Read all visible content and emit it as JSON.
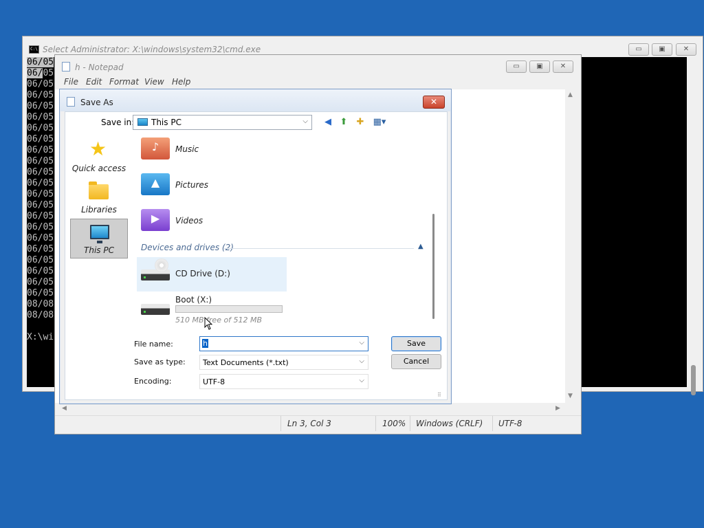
{
  "cmd": {
    "title": "Select Administrator: X:\\windows\\system32\\cmd.exe",
    "icon_text": "C:\\",
    "min_glyph": "▭",
    "max_glyph": "▣",
    "close_glyph": "✕",
    "lines": [
      "06/05",
      "06/05",
      "06/05",
      "06/05",
      "06/05",
      "06/05",
      "06/05",
      "06/05",
      "06/05",
      "06/05",
      "06/05",
      "06/05",
      "06/05",
      "06/05",
      "06/05",
      "06/05",
      "06/05",
      "06/05",
      "06/05",
      "06/05",
      "06/05",
      "06/05",
      "08/08",
      "08/08",
      "",
      "X:\\wi"
    ],
    "first_line": "06/05",
    "second_line_sel": "06/",
    "second_line_rest": "05"
  },
  "notepad": {
    "title": "h - Notepad",
    "menu": [
      "File",
      "Edit",
      "Format",
      "View",
      "Help"
    ],
    "status": {
      "position": "Ln 3, Col 3",
      "zoom": "100%",
      "line_endings": "Windows (CRLF)",
      "encoding": "UTF-8"
    }
  },
  "dialog": {
    "title": "Save As",
    "save_in_label": "Save in:",
    "save_in_value": "This PC",
    "places": [
      {
        "label": "Quick access",
        "icon": "star-icon"
      },
      {
        "label": "Libraries",
        "icon": "folder-icon"
      },
      {
        "label": "This PC",
        "icon": "computer-icon",
        "selected": true
      }
    ],
    "folders": [
      {
        "name": "Music",
        "icon": "music-folder-icon"
      },
      {
        "name": "Pictures",
        "icon": "pictures-folder-icon"
      },
      {
        "name": "Videos",
        "icon": "videos-folder-icon"
      }
    ],
    "group_header": "Devices and drives (2)",
    "drives": [
      {
        "name": "CD Drive (D:)",
        "icon": "cd-drive-icon",
        "hover": true
      },
      {
        "name": "Boot (X:)",
        "icon": "hard-drive-icon",
        "free": "510 MB free of 512 MB",
        "used_fraction": 0.004
      }
    ],
    "file_name_label": "File name:",
    "file_name_value": "h",
    "save_type_label": "Save as type:",
    "save_type_value": "Text Documents (*.txt)",
    "encoding_label": "Encoding:",
    "encoding_value": "UTF-8",
    "save_button": "Save",
    "cancel_button": "Cancel"
  },
  "colors": {
    "desktop": "#1f66b6",
    "close_red": "#c9432c",
    "selection": "#0a64c8"
  }
}
